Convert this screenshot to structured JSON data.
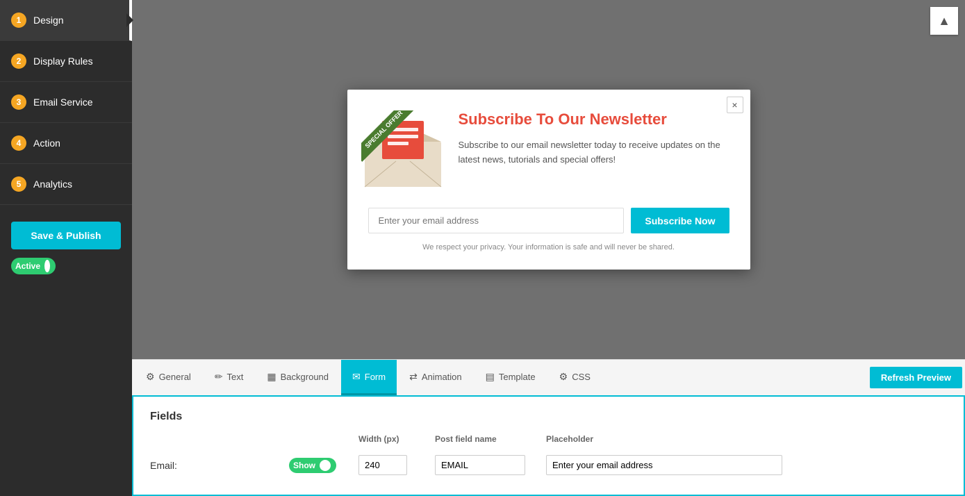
{
  "sidebar": {
    "items": [
      {
        "id": "design",
        "step": "1",
        "label": "Design",
        "active": true
      },
      {
        "id": "display-rules",
        "step": "2",
        "label": "Display Rules",
        "active": false
      },
      {
        "id": "email-service",
        "step": "3",
        "label": "Email Service",
        "active": false
      },
      {
        "id": "action",
        "step": "4",
        "label": "Action",
        "active": false
      },
      {
        "id": "analytics",
        "step": "5",
        "label": "Analytics",
        "active": false
      }
    ],
    "save_publish_label": "Save & Publish",
    "active_label": "Active"
  },
  "modal": {
    "close_label": "×",
    "badge_text": "SPECIAL OFFER",
    "title": "Subscribe To Our Newsletter",
    "description": "Subscribe to our email newsletter today to receive updates on the latest news, tutorials and special offers!",
    "email_placeholder": "Enter your email address",
    "subscribe_button": "Subscribe Now",
    "privacy_text": "We respect your privacy. Your information is safe and will never be shared."
  },
  "tabs": [
    {
      "id": "general",
      "label": "General",
      "icon": "⚙",
      "active": false
    },
    {
      "id": "text",
      "label": "Text",
      "icon": "✏",
      "active": false
    },
    {
      "id": "background",
      "label": "Background",
      "icon": "▦",
      "active": false
    },
    {
      "id": "form",
      "label": "Form",
      "icon": "✉",
      "active": true
    },
    {
      "id": "animation",
      "label": "Animation",
      "icon": "⇄",
      "active": false
    },
    {
      "id": "template",
      "label": "Template",
      "icon": "▤",
      "active": false
    },
    {
      "id": "css",
      "label": "CSS",
      "icon": "⚙",
      "active": false
    }
  ],
  "refresh_preview_label": "Refresh Preview",
  "fields": {
    "title": "Fields",
    "headers": {
      "width": "Width (px)",
      "post_field_name": "Post field name",
      "placeholder": "Placeholder"
    },
    "rows": [
      {
        "label": "Email:",
        "show": "Show",
        "width": "240",
        "post_field_name": "EMAIL",
        "placeholder": "Enter your email address"
      }
    ]
  },
  "colors": {
    "accent": "#00bcd4",
    "active_badge": "#f5a623",
    "sidebar_bg": "#2c2c2c",
    "modal_title": "#e74c3c"
  }
}
